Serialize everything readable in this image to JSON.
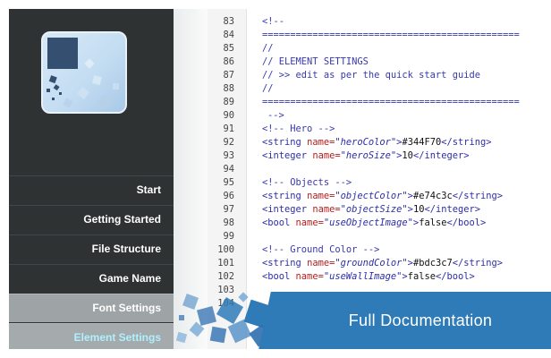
{
  "sidebar": {
    "items": [
      {
        "label": "Start"
      },
      {
        "label": "Getting Started"
      },
      {
        "label": "File Structure"
      },
      {
        "label": "Game Name"
      },
      {
        "label": "Font Settings"
      },
      {
        "label": "Element Settings"
      }
    ],
    "active_item": "Element Settings"
  },
  "code": {
    "line_numbers": [
      "83",
      "84",
      "85",
      "86",
      "87",
      "88",
      "89",
      "90",
      "91",
      "92",
      "93",
      "94",
      "95",
      "96",
      "97",
      "98",
      "99",
      "100",
      "101",
      "102",
      "103",
      "104"
    ],
    "comment_open": "<!--",
    "rule": "==============================================",
    "comment_slashes": "//",
    "section_title": "// ELEMENT SETTINGS",
    "section_hint": "// >> edit as per the quick start guide",
    "comment_close": "-->",
    "hero_comment": "<!-- Hero -->",
    "objects_comment": "<!-- Objects -->",
    "ground_comment": "<!-- Ground Color -->",
    "string_open": "<string",
    "string_close": "</string>",
    "integer_open": "<integer",
    "integer_close": "</integer>",
    "bool_open": "<bool",
    "bool_close": "</bool>",
    "name_attr": "name=",
    "tag_end": ">",
    "hero_color_name": "\"heroColor\"",
    "hero_color_value": "#344F70",
    "hero_size_name": "\"heroSize\"",
    "hero_size_value": "10",
    "object_color_name": "\"objectColor\"",
    "object_color_value": "#e74c3c",
    "object_size_name": "\"objectSize\"",
    "object_size_value": "10",
    "use_object_image_name": "\"useObjectImage\"",
    "use_object_image_value": "false",
    "ground_color_name": "\"groundColor\"",
    "ground_color_value": "#bdc3c7",
    "use_wall_image_name": "\"useWallImage\"",
    "use_wall_image_value": "false"
  },
  "banner": {
    "label": "Full Documentation"
  },
  "colors": {
    "hero": "#344F70",
    "accent_blue": "#2e7bb8",
    "sidebar_bg": "#2e3233",
    "active_text": "#aef0ff"
  }
}
